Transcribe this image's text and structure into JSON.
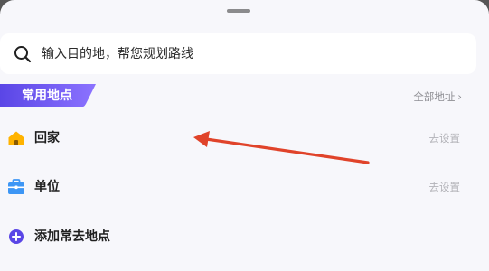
{
  "search": {
    "placeholder": "输入目的地，帮您规划路线"
  },
  "favorites": {
    "tag_label": "常用地点",
    "all_link": "全部地址",
    "items": [
      {
        "label": "回家",
        "action": "去设置",
        "icon": "home-icon"
      },
      {
        "label": "单位",
        "action": "去设置",
        "icon": "briefcase-icon"
      },
      {
        "label": "添加常去地点",
        "icon": "plus-circle-icon"
      }
    ]
  },
  "colors": {
    "tag_gradient_start": "#5a46e6",
    "tag_gradient_end": "#8c73ff",
    "home_icon": "#ffb300",
    "briefcase_icon": "#3d96f5",
    "plus_icon": "#5a46e6",
    "annotation_arrow": "#e0432a"
  }
}
